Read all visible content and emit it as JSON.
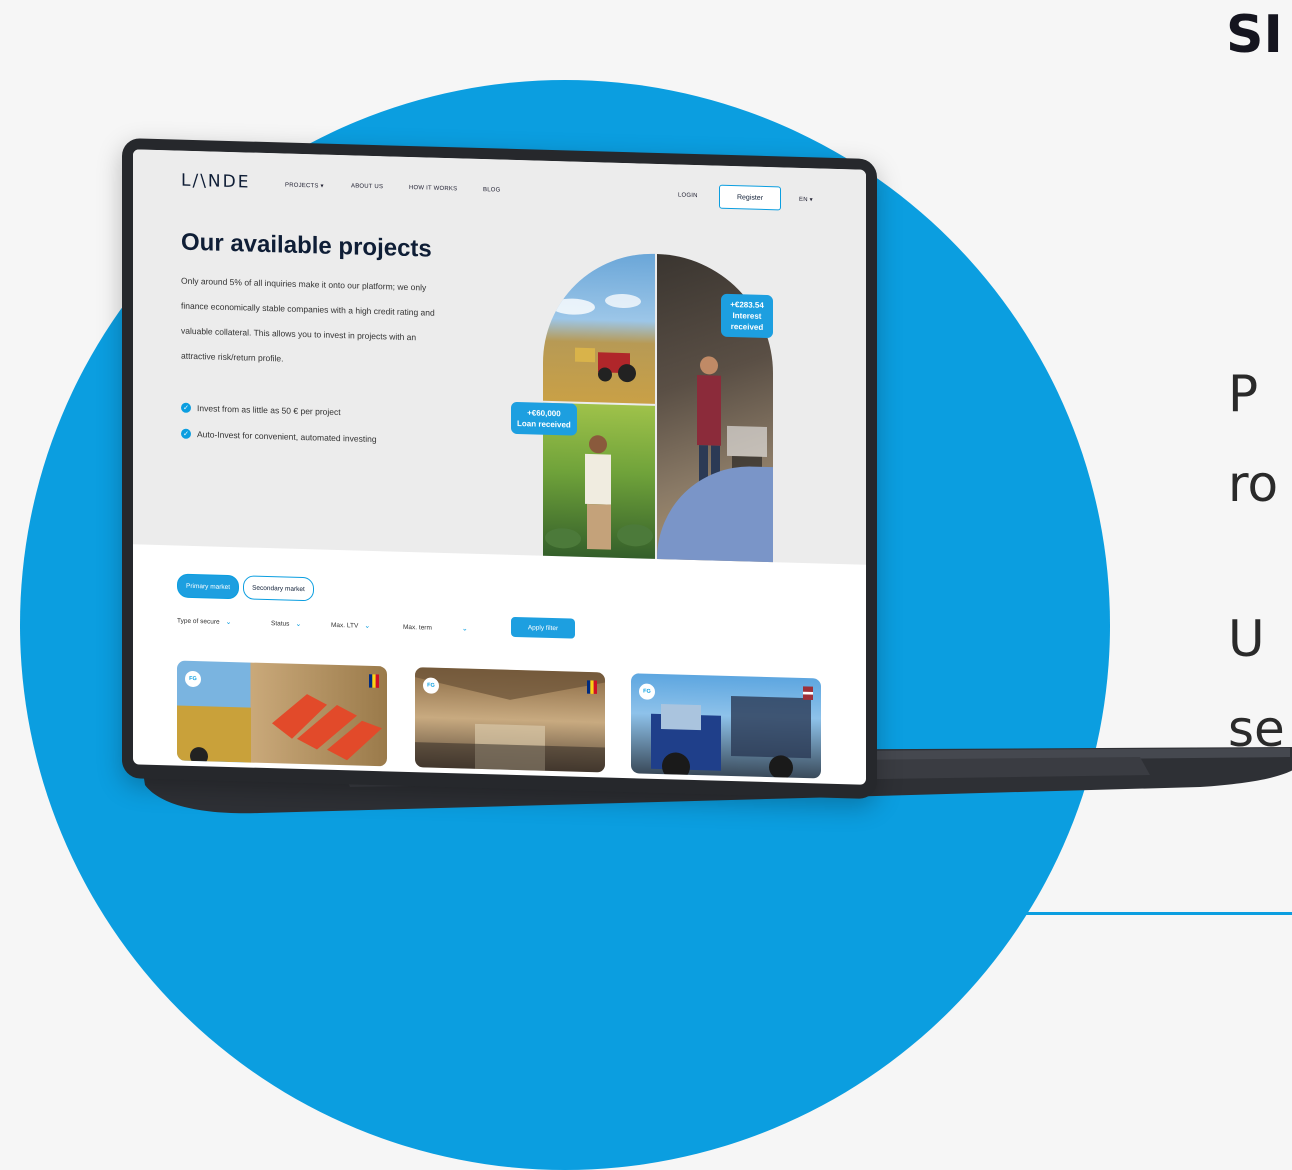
{
  "right_panel": {
    "heading": "SI",
    "lines": [
      "P",
      "ro",
      "U",
      "se"
    ]
  },
  "site": {
    "logo": "L/\\NDE",
    "nav": [
      "PROJECTS",
      "ABOUT US",
      "HOW IT WORKS",
      "BLOG"
    ],
    "nav_dropdown": "▾",
    "login": "LOGIN",
    "register": "Register",
    "language": "EN ▾"
  },
  "hero": {
    "title": "Our available projects",
    "paragraph": "Only around 5% of all inquiries make it onto our platform; we only finance economically stable companies with a high credit rating and valuable collateral. This allows you to invest in projects with an attractive risk/return profile.",
    "bullets": [
      "Invest from as little as 50 € per project",
      "Auto-Invest for convenient, automated investing"
    ],
    "bubble_interest": {
      "amount": "+€283.54",
      "label": "Interest received"
    },
    "bubble_loan": {
      "amount": "+€60,000",
      "label": "Loan received"
    }
  },
  "market": {
    "tabs": [
      "Primary market",
      "Secondary market"
    ],
    "active_tab": "Primary market"
  },
  "filters": {
    "items": [
      "Type of secure",
      "Status",
      "Max. LTV",
      "Max. term"
    ],
    "apply": "Apply filter"
  },
  "cards": [
    {
      "tag": "FG",
      "flag": "romania"
    },
    {
      "tag": "FG",
      "flag": "romania"
    },
    {
      "tag": "FG",
      "flag": "latvia"
    }
  ],
  "colors": {
    "accent": "#0b9ee0",
    "navy": "#0f1e36"
  }
}
